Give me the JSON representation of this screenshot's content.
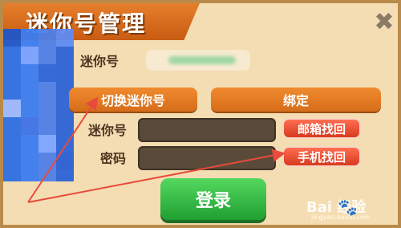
{
  "title": "迷你号管理",
  "close_symbol": "✖",
  "labels": {
    "account_id": "迷你号",
    "password": "密码"
  },
  "tabs": {
    "switch": "切换迷你号",
    "bind": "绑定"
  },
  "buttons": {
    "email_recover": "邮箱找回",
    "phone_recover": "手机找回",
    "login": "登录"
  },
  "watermark": {
    "text": "Bai 经验",
    "url": "jingyan.baidu.com"
  },
  "colors": {
    "panel": "#f4ddb2",
    "title": "#e67f2c",
    "tab": "#f08a2f",
    "recover": "#e64b2e",
    "login": "#2fb23f",
    "arrow": "#e84b3b"
  }
}
